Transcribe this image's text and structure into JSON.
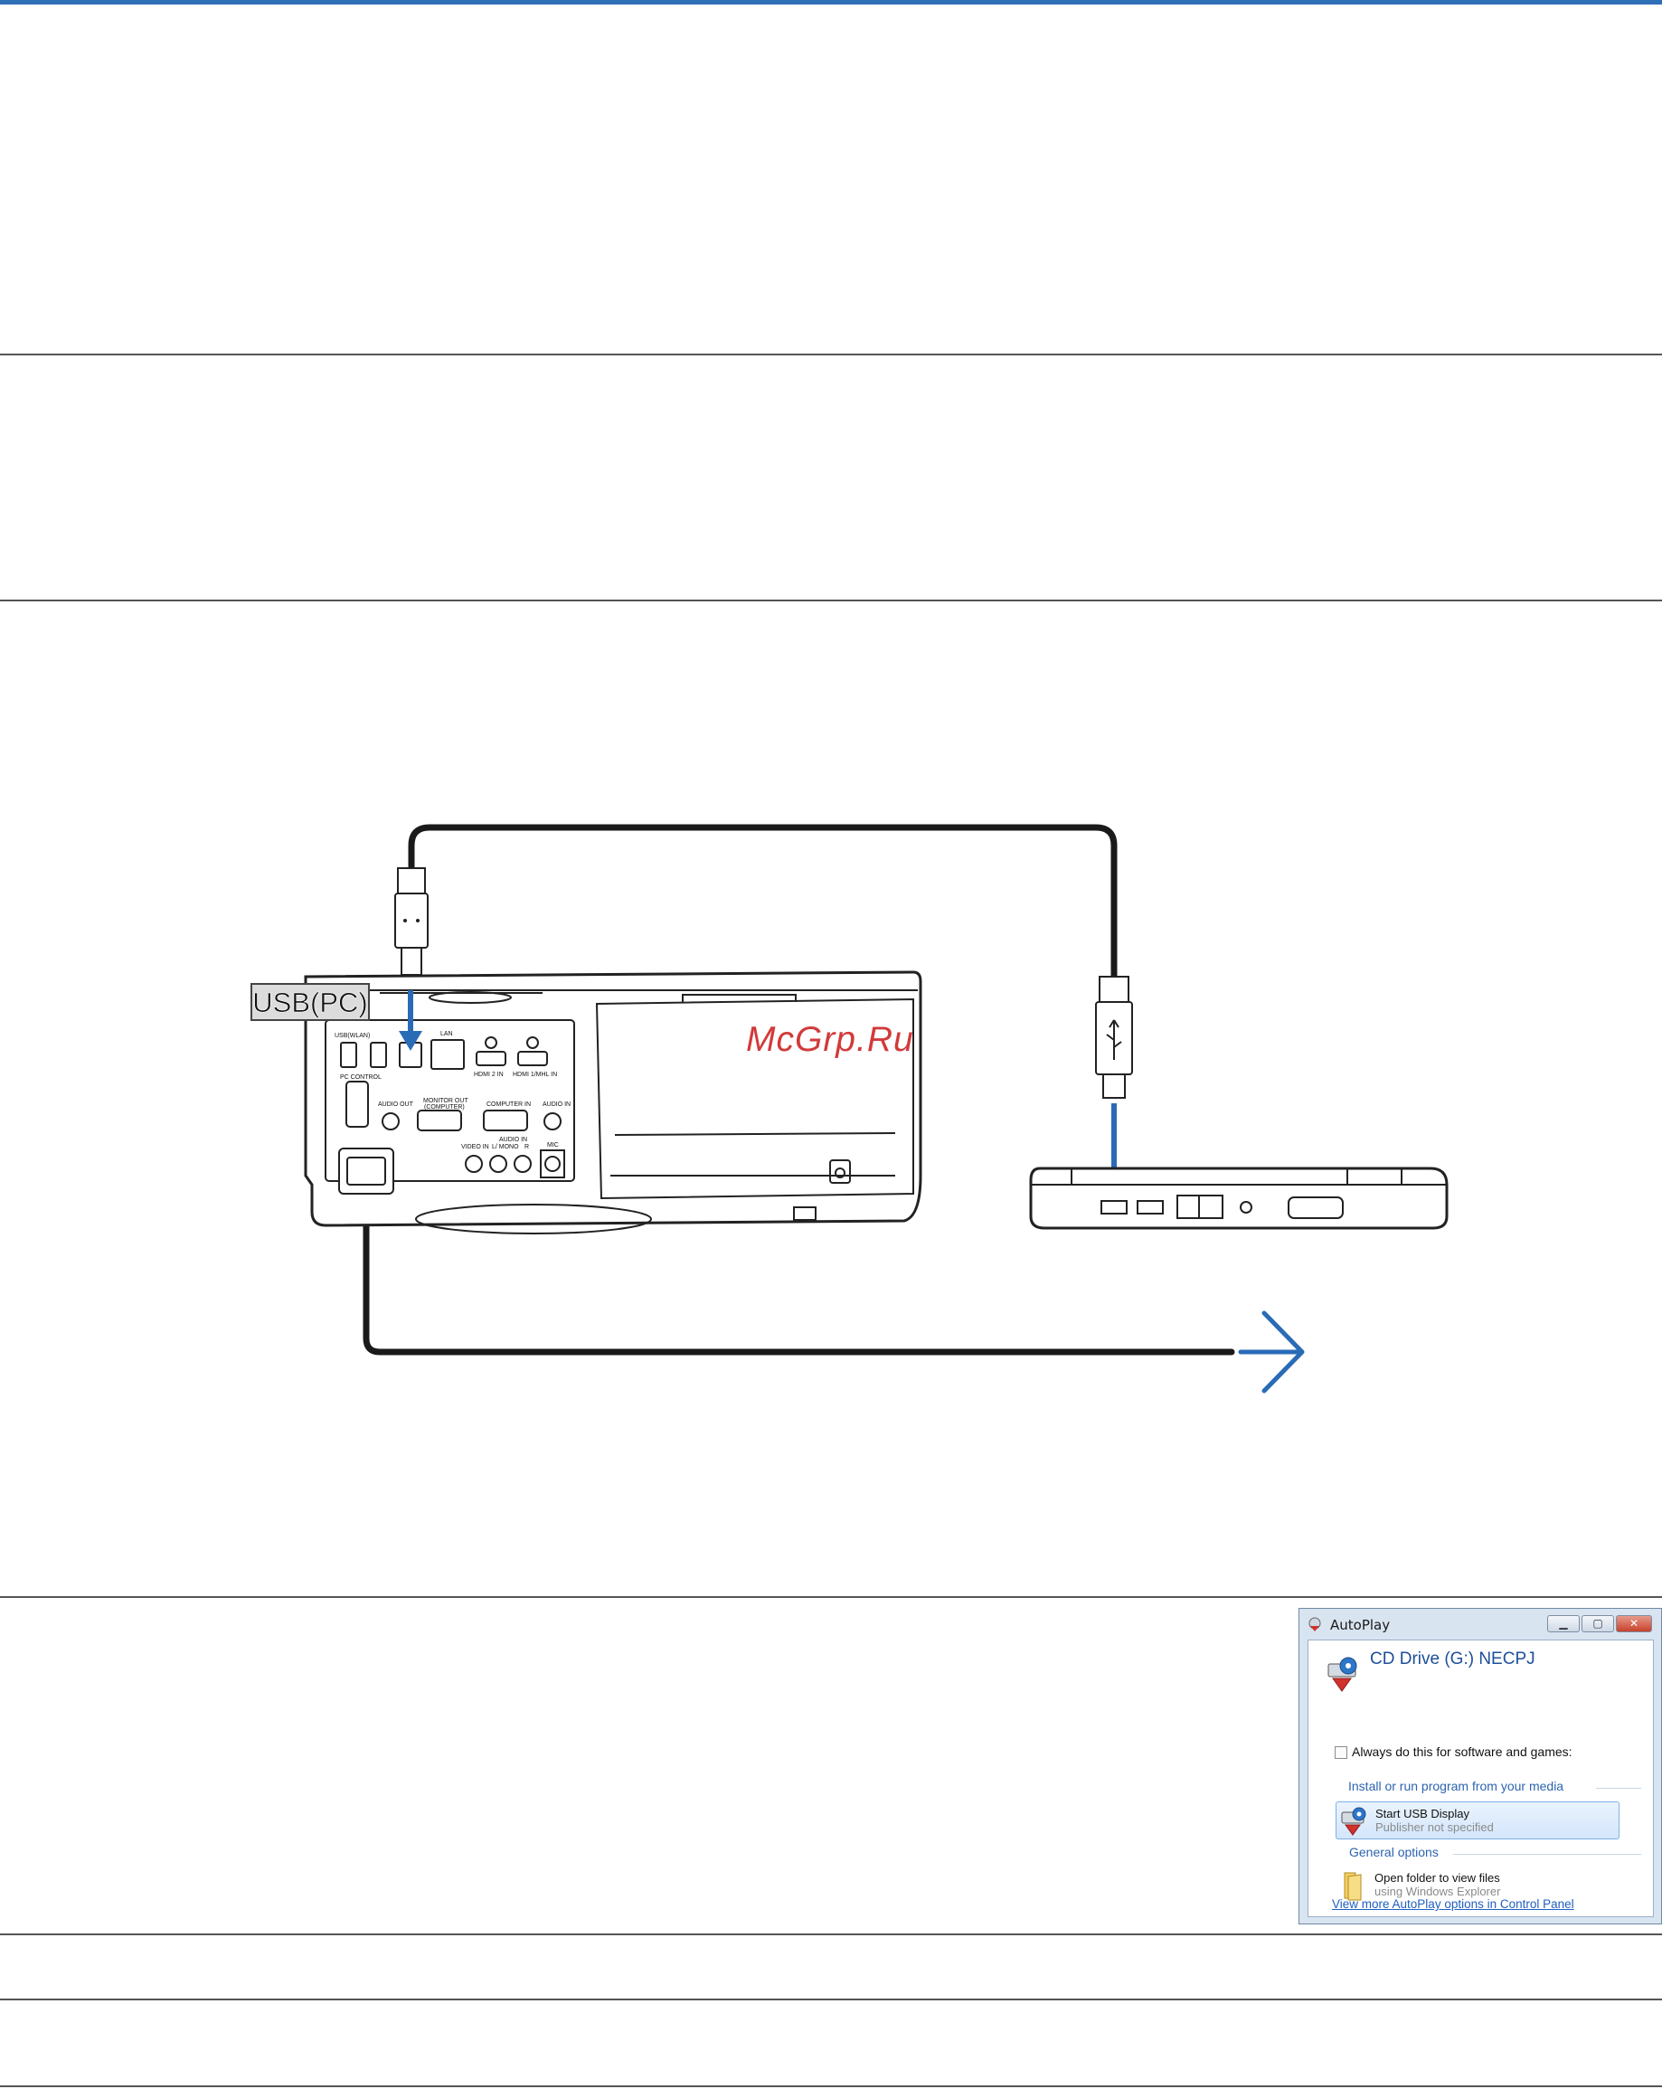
{
  "document": {
    "accent_color": "#2f6fb8",
    "watermark": "McGrp.Ru"
  },
  "diagram": {
    "port_callout": "USB(PC)",
    "projector_labels": {
      "usb_wlan": "USB(WLAN)",
      "usb_pc": "USB(PC)",
      "lan": "LAN",
      "pc_control": "PC CONTROL",
      "hdmi2_in": "HDMI 2 IN",
      "hdmi1_mhl_in": "HDMI 1/MHL IN",
      "audio_out": "AUDIO OUT",
      "monitor_out": "MONITOR OUT",
      "monitor_out_sub": "(COMPUTER)",
      "computer_in": "COMPUTER IN",
      "audio_in": "AUDIO IN",
      "audio_in_2": "AUDIO IN",
      "lr_mono": "L/ MONO",
      "r": "R",
      "video_in": "VIDEO IN",
      "mic": "MIC"
    },
    "cable_color": "#1a1a1a",
    "arrow_color": "#2a6bb6"
  },
  "autoplay": {
    "title": "AutoPlay",
    "minimize_glyph": "▁",
    "maximize_glyph": "▢",
    "close_glyph": "✕",
    "drive_title": "CD Drive (G:) NECPJ",
    "always_label": "Always do this for software and games:",
    "section_install": "Install or run program from your media",
    "option_start": "Start USB Display",
    "option_start_sub": "Publisher not specified",
    "section_general": "General options",
    "option_folder": "Open folder to view files",
    "option_folder_sub": "using Windows Explorer",
    "more_link": "View more AutoPlay options in Control Panel"
  }
}
